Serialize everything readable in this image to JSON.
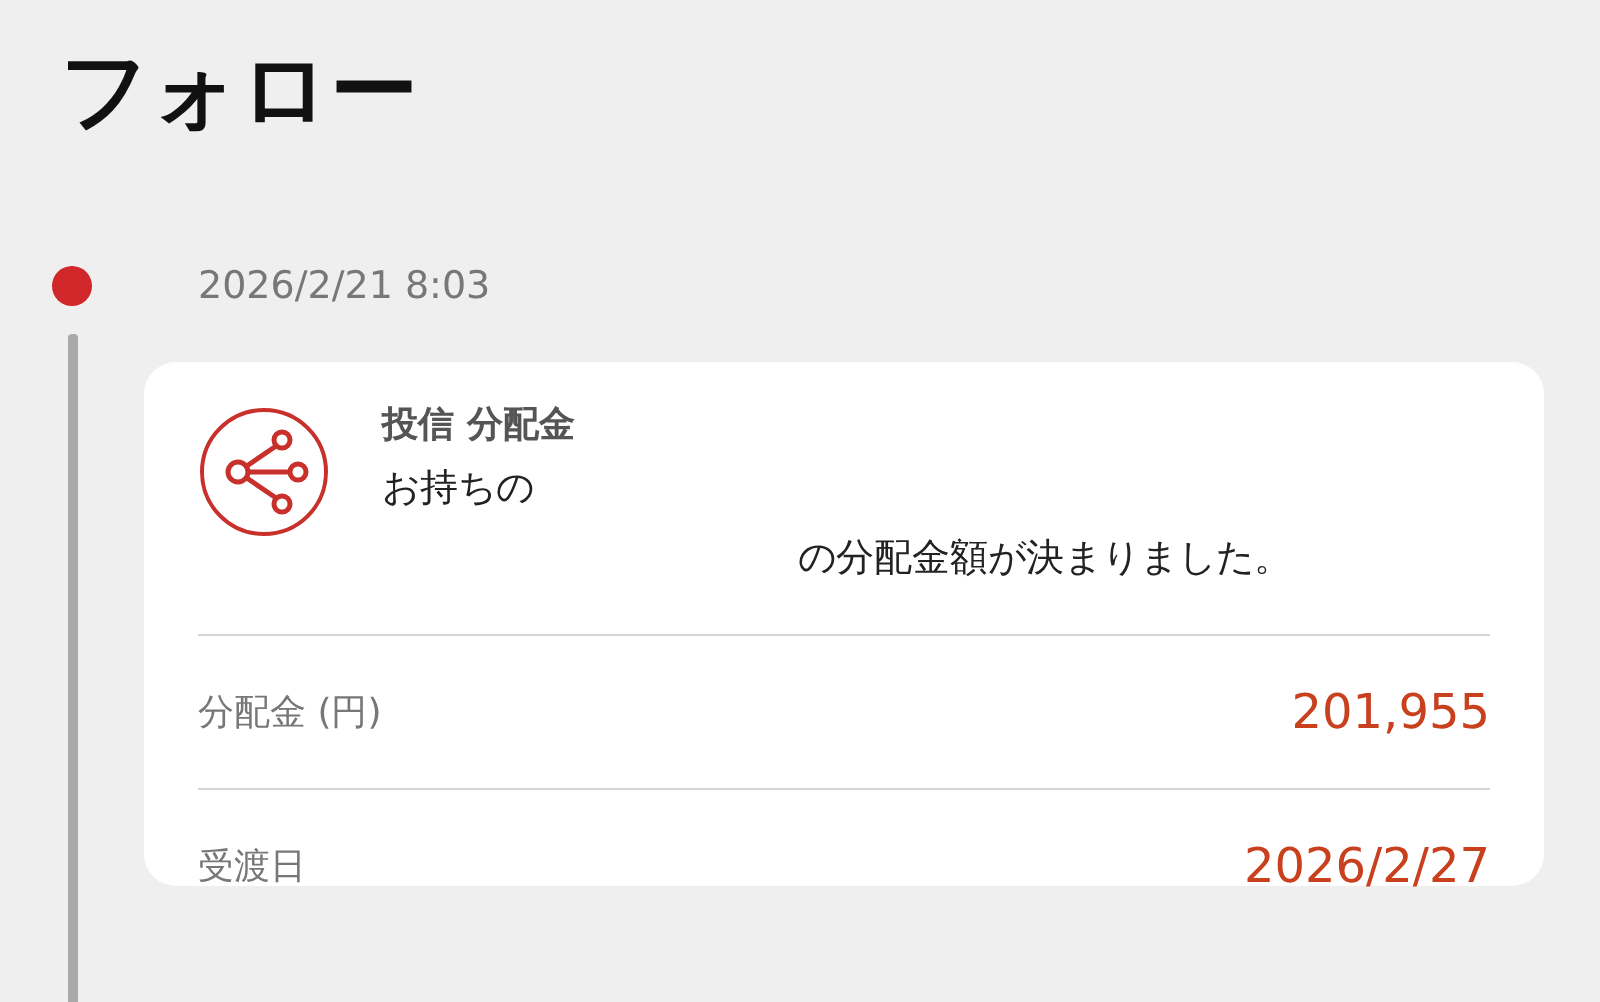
{
  "page": {
    "title": "フォロー"
  },
  "timeline": [
    {
      "time": "2026/2/21 8:03",
      "card": {
        "category": "投信 分配金",
        "message_lines": [
          "お持ちの",
          "の分配金額が決まりました。"
        ],
        "rows": [
          {
            "label": "分配金 (円)",
            "value": "201,955"
          },
          {
            "label": "受渡日",
            "value": "2026/2/27"
          }
        ]
      }
    }
  ]
}
